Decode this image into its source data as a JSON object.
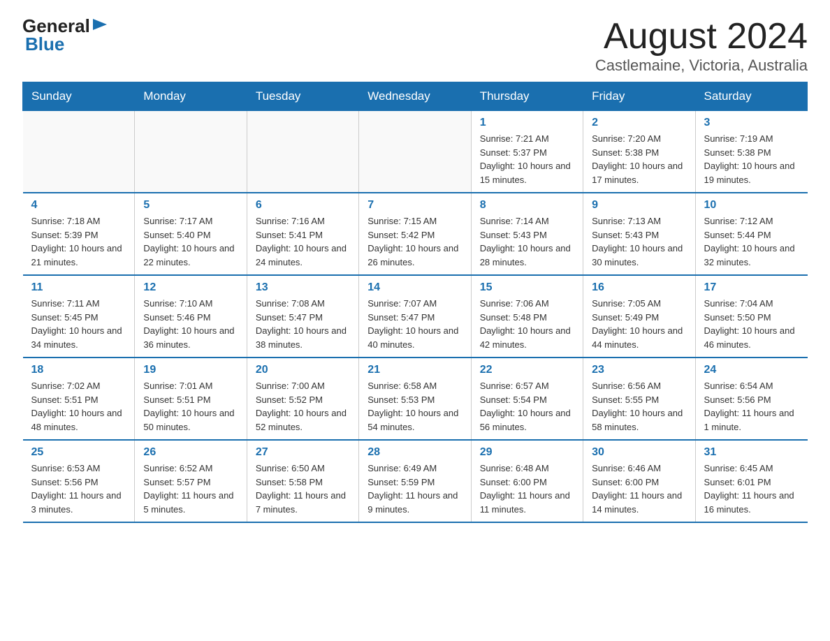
{
  "logo": {
    "general": "General",
    "arrow": "▶",
    "blue": "Blue"
  },
  "title": "August 2024",
  "location": "Castlemaine, Victoria, Australia",
  "headers": [
    "Sunday",
    "Monday",
    "Tuesday",
    "Wednesday",
    "Thursday",
    "Friday",
    "Saturday"
  ],
  "weeks": [
    [
      {
        "day": "",
        "info": ""
      },
      {
        "day": "",
        "info": ""
      },
      {
        "day": "",
        "info": ""
      },
      {
        "day": "",
        "info": ""
      },
      {
        "day": "1",
        "info": "Sunrise: 7:21 AM\nSunset: 5:37 PM\nDaylight: 10 hours and 15 minutes."
      },
      {
        "day": "2",
        "info": "Sunrise: 7:20 AM\nSunset: 5:38 PM\nDaylight: 10 hours and 17 minutes."
      },
      {
        "day": "3",
        "info": "Sunrise: 7:19 AM\nSunset: 5:38 PM\nDaylight: 10 hours and 19 minutes."
      }
    ],
    [
      {
        "day": "4",
        "info": "Sunrise: 7:18 AM\nSunset: 5:39 PM\nDaylight: 10 hours and 21 minutes."
      },
      {
        "day": "5",
        "info": "Sunrise: 7:17 AM\nSunset: 5:40 PM\nDaylight: 10 hours and 22 minutes."
      },
      {
        "day": "6",
        "info": "Sunrise: 7:16 AM\nSunset: 5:41 PM\nDaylight: 10 hours and 24 minutes."
      },
      {
        "day": "7",
        "info": "Sunrise: 7:15 AM\nSunset: 5:42 PM\nDaylight: 10 hours and 26 minutes."
      },
      {
        "day": "8",
        "info": "Sunrise: 7:14 AM\nSunset: 5:43 PM\nDaylight: 10 hours and 28 minutes."
      },
      {
        "day": "9",
        "info": "Sunrise: 7:13 AM\nSunset: 5:43 PM\nDaylight: 10 hours and 30 minutes."
      },
      {
        "day": "10",
        "info": "Sunrise: 7:12 AM\nSunset: 5:44 PM\nDaylight: 10 hours and 32 minutes."
      }
    ],
    [
      {
        "day": "11",
        "info": "Sunrise: 7:11 AM\nSunset: 5:45 PM\nDaylight: 10 hours and 34 minutes."
      },
      {
        "day": "12",
        "info": "Sunrise: 7:10 AM\nSunset: 5:46 PM\nDaylight: 10 hours and 36 minutes."
      },
      {
        "day": "13",
        "info": "Sunrise: 7:08 AM\nSunset: 5:47 PM\nDaylight: 10 hours and 38 minutes."
      },
      {
        "day": "14",
        "info": "Sunrise: 7:07 AM\nSunset: 5:47 PM\nDaylight: 10 hours and 40 minutes."
      },
      {
        "day": "15",
        "info": "Sunrise: 7:06 AM\nSunset: 5:48 PM\nDaylight: 10 hours and 42 minutes."
      },
      {
        "day": "16",
        "info": "Sunrise: 7:05 AM\nSunset: 5:49 PM\nDaylight: 10 hours and 44 minutes."
      },
      {
        "day": "17",
        "info": "Sunrise: 7:04 AM\nSunset: 5:50 PM\nDaylight: 10 hours and 46 minutes."
      }
    ],
    [
      {
        "day": "18",
        "info": "Sunrise: 7:02 AM\nSunset: 5:51 PM\nDaylight: 10 hours and 48 minutes."
      },
      {
        "day": "19",
        "info": "Sunrise: 7:01 AM\nSunset: 5:51 PM\nDaylight: 10 hours and 50 minutes."
      },
      {
        "day": "20",
        "info": "Sunrise: 7:00 AM\nSunset: 5:52 PM\nDaylight: 10 hours and 52 minutes."
      },
      {
        "day": "21",
        "info": "Sunrise: 6:58 AM\nSunset: 5:53 PM\nDaylight: 10 hours and 54 minutes."
      },
      {
        "day": "22",
        "info": "Sunrise: 6:57 AM\nSunset: 5:54 PM\nDaylight: 10 hours and 56 minutes."
      },
      {
        "day": "23",
        "info": "Sunrise: 6:56 AM\nSunset: 5:55 PM\nDaylight: 10 hours and 58 minutes."
      },
      {
        "day": "24",
        "info": "Sunrise: 6:54 AM\nSunset: 5:56 PM\nDaylight: 11 hours and 1 minute."
      }
    ],
    [
      {
        "day": "25",
        "info": "Sunrise: 6:53 AM\nSunset: 5:56 PM\nDaylight: 11 hours and 3 minutes."
      },
      {
        "day": "26",
        "info": "Sunrise: 6:52 AM\nSunset: 5:57 PM\nDaylight: 11 hours and 5 minutes."
      },
      {
        "day": "27",
        "info": "Sunrise: 6:50 AM\nSunset: 5:58 PM\nDaylight: 11 hours and 7 minutes."
      },
      {
        "day": "28",
        "info": "Sunrise: 6:49 AM\nSunset: 5:59 PM\nDaylight: 11 hours and 9 minutes."
      },
      {
        "day": "29",
        "info": "Sunrise: 6:48 AM\nSunset: 6:00 PM\nDaylight: 11 hours and 11 minutes."
      },
      {
        "day": "30",
        "info": "Sunrise: 6:46 AM\nSunset: 6:00 PM\nDaylight: 11 hours and 14 minutes."
      },
      {
        "day": "31",
        "info": "Sunrise: 6:45 AM\nSunset: 6:01 PM\nDaylight: 11 hours and 16 minutes."
      }
    ]
  ]
}
